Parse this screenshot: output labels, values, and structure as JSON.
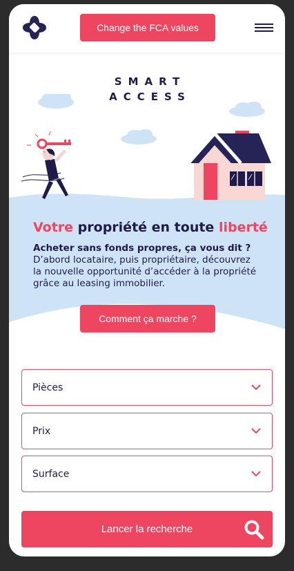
{
  "header": {
    "fca_button_label": "Change the FCA values"
  },
  "hero": {
    "brand_line1": "SMART",
    "brand_line2": "ACCESS",
    "headline_part1": "Votre",
    "headline_part2": " propriété en toute ",
    "headline_part3": "liberté",
    "subheading": "Acheter sans fonds propres, ça vous dit ?",
    "body": "D’abord locataire, puis propriétaire, découvrez la nouvelle opportunité d’accéder à la propriété grâce au leasing immobilier.",
    "cta_label": "Comment ça marche ?"
  },
  "search": {
    "fields": [
      {
        "label": "Pièces"
      },
      {
        "label": "Prix"
      },
      {
        "label": "Surface"
      }
    ],
    "submit_label": "Lancer la recherche"
  },
  "colors": {
    "accent": "#ee4560",
    "navy": "#1e1b4b",
    "light_blue": "#cfe3f6"
  }
}
